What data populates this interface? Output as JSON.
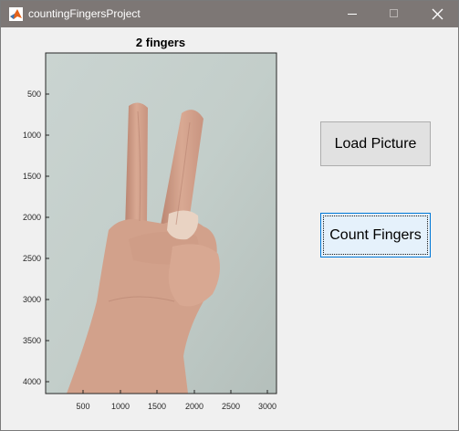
{
  "window": {
    "title": "countingFingersProject",
    "controls": {
      "minimize": "minimize",
      "maximize": "maximize",
      "close": "close"
    }
  },
  "plot": {
    "title": "2 fingers",
    "y_ticks": [
      "500",
      "1000",
      "1500",
      "2000",
      "2500",
      "3000",
      "3500",
      "4000"
    ],
    "x_ticks": [
      "500",
      "1000",
      "1500",
      "2000",
      "2500",
      "3000"
    ],
    "image_subject": "hand showing two fingers (victory sign) against a white wall"
  },
  "buttons": {
    "load_picture": "Load Picture",
    "count_fingers": "Count Fingers"
  },
  "colors": {
    "titlebar": "#7d7775",
    "wall": "#c5d0cd",
    "skin": "#d8a892",
    "focused_button_bg": "#e5f1fb",
    "focused_button_border": "#0078d7"
  }
}
